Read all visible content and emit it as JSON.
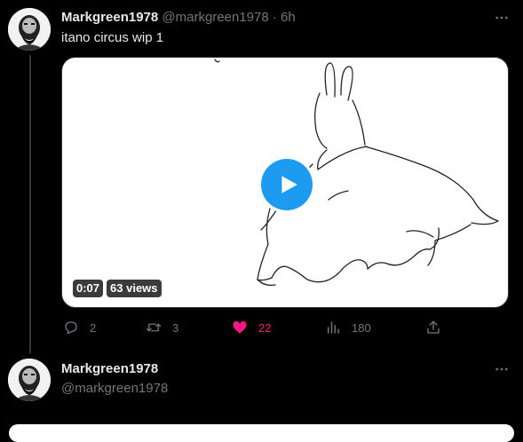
{
  "tweet1": {
    "display_name": "Markgreen1978",
    "handle": "@markgreen1978",
    "separator": "·",
    "time": "6h",
    "text": "itano circus wip 1",
    "video": {
      "duration": "0:07",
      "views": "63 views"
    },
    "actions": {
      "replies": "2",
      "retweets": "3",
      "likes": "22",
      "views": "180"
    },
    "like_color": "#f91880"
  },
  "tweet2": {
    "display_name": "Markgreen1978",
    "handle": "@markgreen1978"
  },
  "colors": {
    "background": "#000000",
    "text_primary": "#e7e9ea",
    "text_secondary": "#71767b",
    "accent": "#1d9bf0"
  },
  "icons": [
    "more-icon",
    "play-icon",
    "reply-icon",
    "retweet-icon",
    "heart-icon",
    "views-icon",
    "share-icon"
  ]
}
